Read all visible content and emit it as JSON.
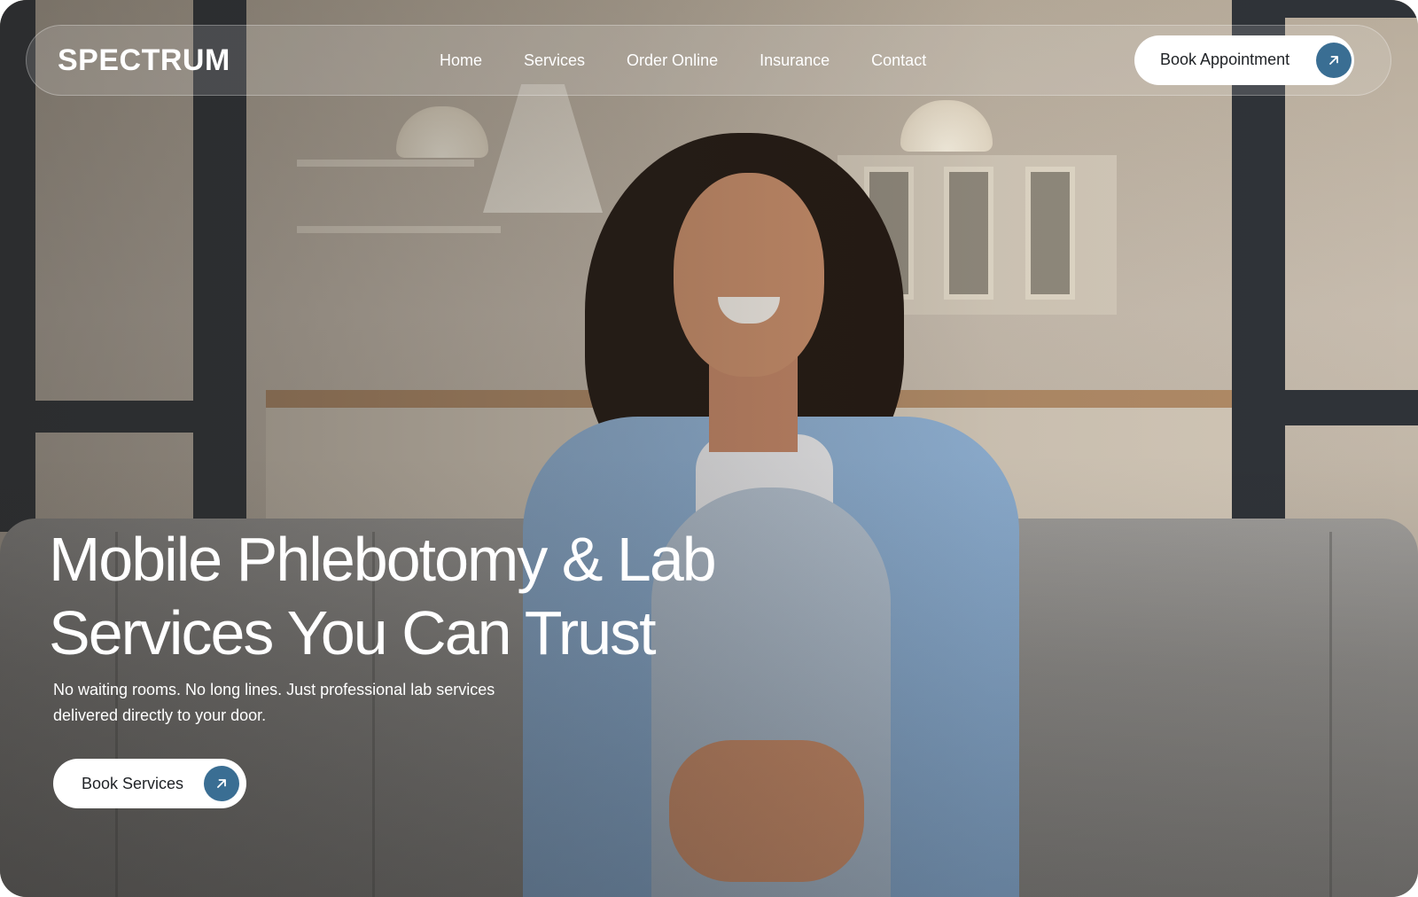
{
  "brand": {
    "logo_text": "SPECTRUM"
  },
  "nav": {
    "links": [
      {
        "label": "Home"
      },
      {
        "label": "Services"
      },
      {
        "label": "Order Online"
      },
      {
        "label": "Insurance"
      },
      {
        "label": "Contact"
      }
    ],
    "cta_label": "Book Appointment",
    "cta_icon": "arrow-up-right-icon"
  },
  "hero": {
    "headline_line1": "Mobile Phlebotomy & Lab",
    "headline_line2": "Services You Can Trust",
    "subtext_line1": "No waiting rooms. No long lines. Just professional lab services",
    "subtext_line2": "delivered directly to your door.",
    "cta_label": "Book Services",
    "cta_icon": "arrow-up-right-icon"
  },
  "colors": {
    "accent": "#3a6e93",
    "text_light": "#ffffff",
    "pill_background": "#ffffff",
    "pill_text": "#1f2226"
  }
}
